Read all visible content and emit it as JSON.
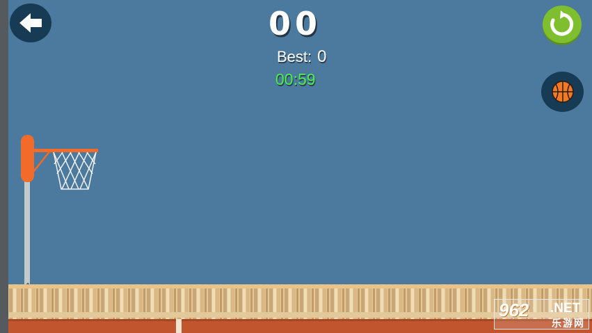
{
  "hud": {
    "score": [
      "0",
      "0"
    ],
    "best_label": "Best:",
    "best_value": "0",
    "timer": "00:59"
  },
  "buttons": {
    "back_icon": "arrow-left-icon",
    "restart_icon": "restart-icon",
    "ball_icon": "basketball-icon"
  },
  "watermark": {
    "number": "962",
    "domain": ".NET",
    "subtitle": "乐游网"
  },
  "colors": {
    "sky": "#4b7a9e",
    "button_dark": "#183b55",
    "restart_green": "#7fbf2f",
    "timer_green": "#49f04a",
    "rim_orange": "#f26b2a",
    "floor_brown": "#c0552e"
  }
}
